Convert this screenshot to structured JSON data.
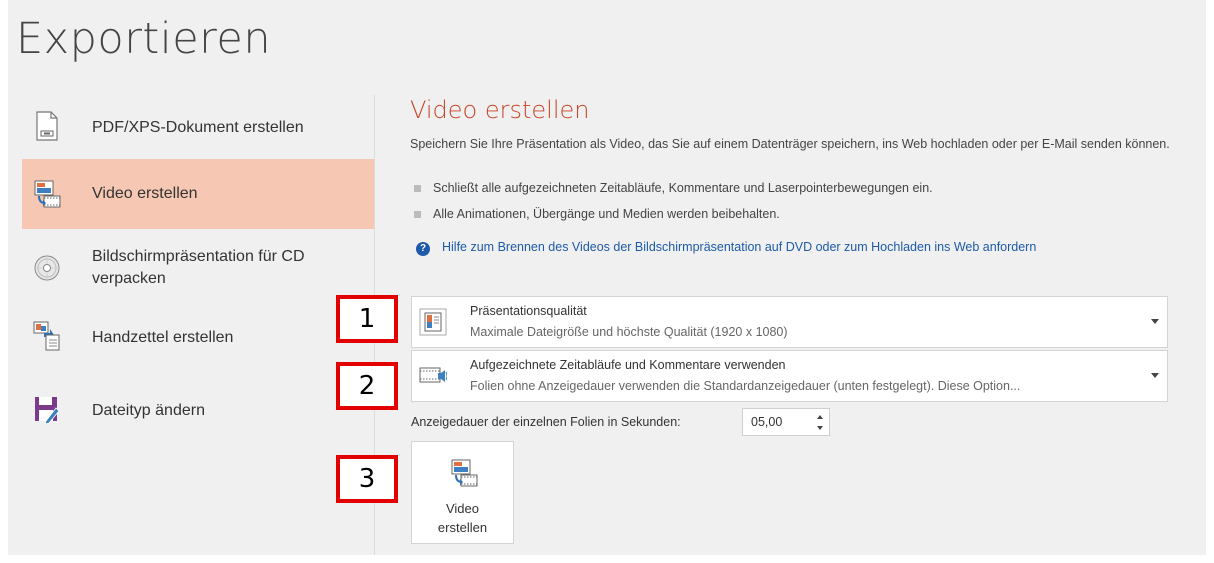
{
  "page": {
    "title": "Exportieren"
  },
  "nav": {
    "items": [
      {
        "label": "PDF/XPS-Dokument erstellen"
      },
      {
        "label": "Video erstellen"
      },
      {
        "label_line1": "Bildschirmpräsentation für CD",
        "label_line2": "verpacken"
      },
      {
        "label": "Handzettel erstellen"
      },
      {
        "label": "Dateityp ändern"
      }
    ],
    "active_color": "#f6c8b3"
  },
  "main": {
    "title": "Video erstellen",
    "description": "Speichern Sie Ihre Präsentation als Video, das Sie auf einem Datenträger speichern, ins Web hochladen oder per E-Mail senden können.",
    "bullets": [
      "Schließt alle aufgezeichneten Zeitabläufe, Kommentare und Laserpointerbewegungen ein.",
      "Alle Animationen, Übergänge und Medien werden beibehalten."
    ],
    "help_link": "Hilfe zum Brennen des Videos der Bildschirmpräsentation auf DVD oder zum Hochladen ins Web anfordern",
    "quality_dropdown": {
      "title": "Präsentationsqualität",
      "subtitle": "Maximale Dateigröße und höchste Qualität (1920 x 1080)"
    },
    "timing_dropdown": {
      "title": "Aufgezeichnete Zeitabläufe und Kommentare verwenden",
      "subtitle": "Folien ohne Anzeigedauer verwenden die Standardanzeigedauer (unten festgelegt). Diese Option..."
    },
    "duration": {
      "label": "Anzeigedauer der einzelnen Folien in Sekunden:",
      "value": "05,00"
    },
    "create_button": {
      "line1": "Video",
      "line2": "erstellen"
    }
  },
  "callouts": [
    "1",
    "2",
    "3"
  ],
  "colors": {
    "accent_title": "#c8452a",
    "link": "#1e5aa8",
    "callout_border": "#e30000"
  }
}
